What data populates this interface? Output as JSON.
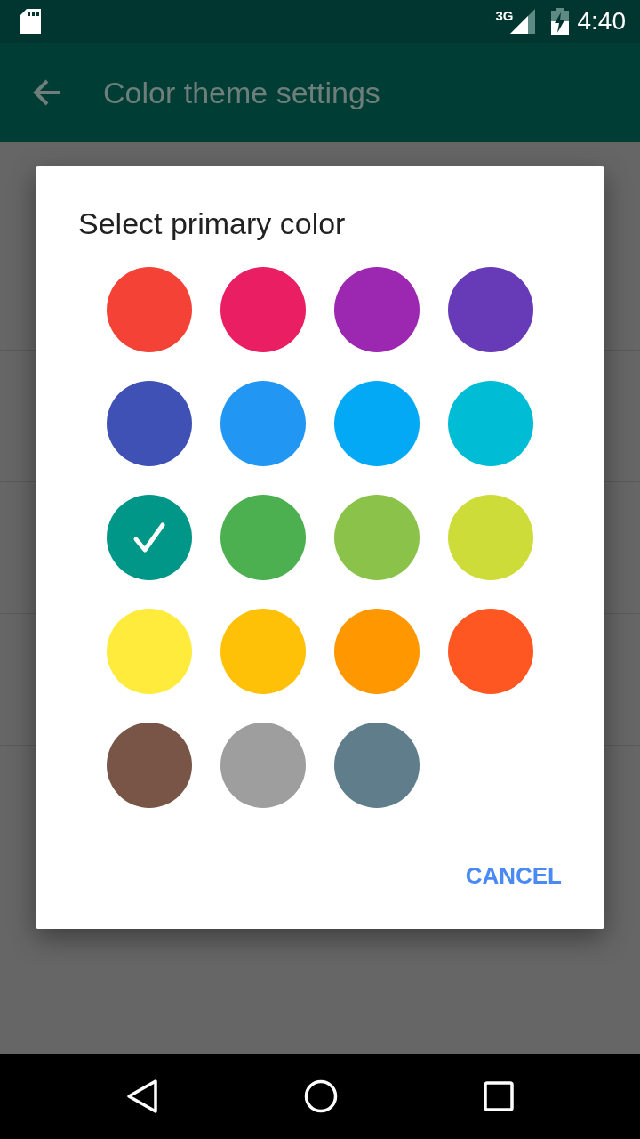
{
  "status_bar": {
    "network": "3G",
    "time": "4:40"
  },
  "app_bar": {
    "title": "Color theme settings"
  },
  "dialog": {
    "title": "Select primary color",
    "swatches": [
      {
        "color": "#f44336",
        "selected": false
      },
      {
        "color": "#e91e63",
        "selected": false
      },
      {
        "color": "#9c27b0",
        "selected": false
      },
      {
        "color": "#673ab7",
        "selected": false
      },
      {
        "color": "#3f51b5",
        "selected": false
      },
      {
        "color": "#2196f3",
        "selected": false
      },
      {
        "color": "#03a9f4",
        "selected": false
      },
      {
        "color": "#00bcd4",
        "selected": false
      },
      {
        "color": "#009688",
        "selected": true
      },
      {
        "color": "#4caf50",
        "selected": false
      },
      {
        "color": "#8bc34a",
        "selected": false
      },
      {
        "color": "#cddc39",
        "selected": false
      },
      {
        "color": "#ffeb3b",
        "selected": false
      },
      {
        "color": "#ffc107",
        "selected": false
      },
      {
        "color": "#ff9800",
        "selected": false
      },
      {
        "color": "#ff5722",
        "selected": false
      },
      {
        "color": "#795548",
        "selected": false
      },
      {
        "color": "#9e9e9e",
        "selected": false
      },
      {
        "color": "#607d8b",
        "selected": false
      }
    ],
    "buttons": [
      "CANCEL"
    ]
  }
}
